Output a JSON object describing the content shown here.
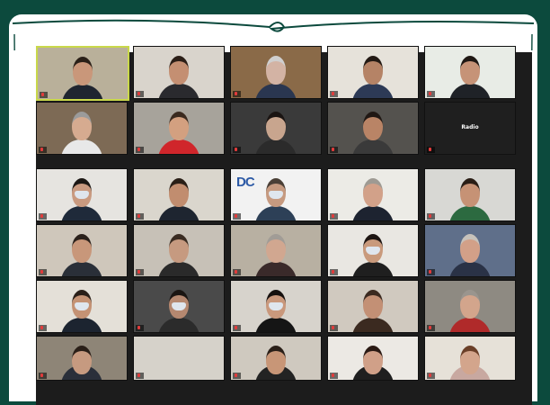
{
  "meeting": {
    "participants": [
      {
        "name": "",
        "bg": "#b9b09a",
        "skin": "#c9977a",
        "hair": "#2a2018",
        "shirt": "#1f2530",
        "mask": false,
        "active": true
      },
      {
        "name": "",
        "bg": "#d9d4cc",
        "skin": "#c48f72",
        "hair": "#2b1e17",
        "shirt": "#2a2a2e",
        "mask": false
      },
      {
        "name": "",
        "bg": "#8a6a48",
        "skin": "#d3b3a4",
        "hair": "#cfcfcf",
        "shirt": "#2a3650",
        "mask": false
      },
      {
        "name": "",
        "bg": "#e6e2da",
        "skin": "#b58366",
        "hair": "#231a14",
        "shirt": "#2d3a56",
        "mask": false
      },
      {
        "name": "",
        "bg": "#e8ece6",
        "skin": "#c69377",
        "hair": "#1f1814",
        "shirt": "#1f2227",
        "mask": false
      },
      {
        "name": "",
        "bg": "#7d6a55",
        "skin": "#d6ab90",
        "hair": "#9b9b9b",
        "shirt": "#e8e8e8",
        "mask": false
      },
      {
        "name": "",
        "bg": "#a7a39b",
        "skin": "#d3a080",
        "hair": "#3a2a1f",
        "shirt": "#d0262b",
        "mask": false
      },
      {
        "name": "",
        "bg": "#3a3a3a",
        "skin": "#c8a58e",
        "hair": "#1a1412",
        "shirt": "#2b2b2b",
        "mask": false
      },
      {
        "name": "",
        "bg": "#54524e",
        "skin": "#b98466",
        "hair": "#201814",
        "shirt": "#3a3a3a",
        "mask": false
      },
      {
        "name": "",
        "center": "Radio",
        "bg": "#1f1f1f",
        "skin": "",
        "hair": "",
        "shirt": "",
        "mask": false
      },
      {
        "name": "",
        "bg": "#e6e4e0",
        "skin": "#c99a80",
        "hair": "#1c1714",
        "shirt": "#1f2a3a",
        "mask": true
      },
      {
        "name": "",
        "bg": "#dad6cd",
        "skin": "#c18d6f",
        "hair": "#2a1f17",
        "shirt": "#1e2530",
        "mask": false
      },
      {
        "name": "",
        "logo": "DC",
        "bg": "#f2f2f2",
        "skin": "#c69a80",
        "hair": "#4a3f36",
        "shirt": "#2d4057",
        "mask": true
      },
      {
        "name": "",
        "bg": "#ecebe6",
        "skin": "#d2a189",
        "hair": "#9e9a93",
        "shirt": "#1d2330",
        "mask": false
      },
      {
        "name": "",
        "bg": "#d8d8d4",
        "skin": "#c69275",
        "hair": "#2a1e16",
        "shirt": "#2c6a40",
        "mask": false
      },
      {
        "name": "",
        "bg": "#cfc7bb",
        "skin": "#c8977a",
        "hair": "#2b211b",
        "shirt": "#2a2f38",
        "mask": false
      },
      {
        "name": "",
        "bg": "#c7c1b7",
        "skin": "#c69a80",
        "hair": "#3a2c22",
        "shirt": "#2a2a2a",
        "mask": false
      },
      {
        "name": "",
        "bg": "#b8b0a2",
        "skin": "#d1a790",
        "hair": "#a19c96",
        "shirt": "#3a2a2a",
        "mask": false
      },
      {
        "name": "",
        "bg": "#e9e7e2",
        "skin": "#c99a7c",
        "hair": "#1d1512",
        "shirt": "#1f1f1f",
        "mask": true
      },
      {
        "name": "",
        "bg": "#5f6f8a",
        "skin": "#d2a088",
        "hair": "#c7c2bb",
        "shirt": "#2a3246",
        "mask": false
      },
      {
        "name": "",
        "bg": "#e4e0d8",
        "skin": "#c49274",
        "hair": "#2a1f18",
        "shirt": "#1c2430",
        "mask": true
      },
      {
        "name": "",
        "bg": "#4a4a4a",
        "skin": "#b58870",
        "hair": "#1a1512",
        "shirt": "#2b2b2b",
        "mask": true
      },
      {
        "name": "",
        "bg": "#d7d3cc",
        "skin": "#c9987c",
        "hair": "#15100e",
        "shirt": "#151515",
        "mask": true
      },
      {
        "name": "",
        "bg": "#d0c9bf",
        "skin": "#c39075",
        "hair": "#3b2a20",
        "shirt": "#3b2a20",
        "mask": false
      },
      {
        "name": "",
        "bg": "#8e8a82",
        "skin": "#d3a58c",
        "hair": "#9a958e",
        "shirt": "#b02a2a",
        "mask": false
      },
      {
        "name": "",
        "bg": "#8e8577",
        "skin": "#c69a80",
        "hair": "#2a1f18",
        "shirt": "#2a2f3a",
        "mask": false
      },
      {
        "name": "",
        "bg": "#d6d2ca",
        "skin": "",
        "hair": "",
        "shirt": "",
        "mask": false
      },
      {
        "name": "",
        "bg": "#cfc9bf",
        "skin": "#c89677",
        "hair": "#2a1f18",
        "shirt": "#232323",
        "mask": false
      },
      {
        "name": "",
        "bg": "#ece9e4",
        "skin": "#d0a088",
        "hair": "#2a1a14",
        "shirt": "#1f1f1f",
        "mask": false
      },
      {
        "name": "",
        "bg": "#e6e1d8",
        "skin": "#d3a58c",
        "hair": "#6a3f28",
        "shirt": "#c8a8a0",
        "mask": false
      }
    ]
  }
}
